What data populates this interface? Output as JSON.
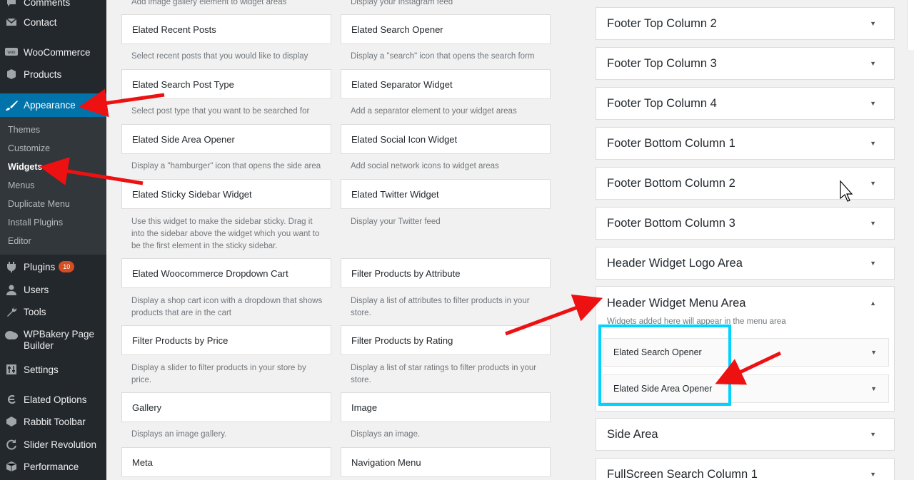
{
  "sidebar": {
    "top_cut": "Comments",
    "items": [
      {
        "label": "Contact",
        "icon": "mail-icon"
      },
      {
        "label": "WooCommerce",
        "icon": "woocommerce-icon"
      },
      {
        "label": "Products",
        "icon": "box-icon"
      },
      {
        "label": "Appearance",
        "icon": "paintbrush-icon"
      },
      {
        "label": "Plugins",
        "icon": "plug-icon",
        "badge": "10"
      },
      {
        "label": "Users",
        "icon": "user-icon"
      },
      {
        "label": "Tools",
        "icon": "wrench-icon"
      },
      {
        "label": "WPBakery Page Builder",
        "icon": "wpbakery-icon"
      },
      {
        "label": "Settings",
        "icon": "sliders-icon"
      },
      {
        "label": "Elated Options",
        "icon": "elated-icon"
      },
      {
        "label": "Rabbit Toolbar",
        "icon": "rabbit-icon"
      },
      {
        "label": "Slider Revolution",
        "icon": "refresh-icon"
      },
      {
        "label": "Performance",
        "icon": "cube-icon"
      }
    ],
    "submenu": [
      "Themes",
      "Customize",
      "Widgets",
      "Menus",
      "Duplicate Menu",
      "Install Plugins",
      "Editor"
    ]
  },
  "widgets": {
    "top_desc_left": "Add image gallery element to widget areas",
    "top_desc_right": "Display your Instagram feed",
    "rows": [
      [
        {
          "title": "Elated Recent Posts",
          "desc": "Select recent posts that you would like to display"
        },
        {
          "title": "Elated Search Opener",
          "desc": "Display a \"search\" icon that opens the search form"
        }
      ],
      [
        {
          "title": "Elated Search Post Type",
          "desc": "Select post type that you want to be searched for"
        },
        {
          "title": "Elated Separator Widget",
          "desc": "Add a separator element to your widget areas"
        }
      ],
      [
        {
          "title": "Elated Side Area Opener",
          "desc": "Display a \"hamburger\" icon that opens the side area"
        },
        {
          "title": "Elated Social Icon Widget",
          "desc": "Add social network icons to widget areas"
        }
      ],
      [
        {
          "title": "Elated Sticky Sidebar Widget",
          "desc": "Use this widget to make the sidebar sticky. Drag it into the sidebar above the widget which you want to be the first element in the sticky sidebar."
        },
        {
          "title": "Elated Twitter Widget",
          "desc": "Display your Twitter feed"
        }
      ],
      [
        {
          "title": "Elated Woocommerce Dropdown Cart",
          "desc": "Display a shop cart icon with a dropdown that shows products that are in the cart"
        },
        {
          "title": "Filter Products by Attribute",
          "desc": "Display a list of attributes to filter products in your store."
        }
      ],
      [
        {
          "title": "Filter Products by Price",
          "desc": "Display a slider to filter products in your store by price."
        },
        {
          "title": "Filter Products by Rating",
          "desc": "Display a list of star ratings to filter products in your store."
        }
      ],
      [
        {
          "title": "Gallery",
          "desc": "Displays an image gallery."
        },
        {
          "title": "Image",
          "desc": "Displays an image."
        }
      ],
      [
        {
          "title": "Meta",
          "desc": ""
        },
        {
          "title": "Navigation Menu",
          "desc": ""
        }
      ]
    ]
  },
  "areas": {
    "list_top": [
      "Footer Top Column 2",
      "Footer Top Column 3",
      "Footer Top Column 4",
      "Footer Bottom Column 1",
      "Footer Bottom Column 2",
      "Footer Bottom Column 3",
      "Header Widget Logo Area"
    ],
    "open": {
      "title": "Header Widget Menu Area",
      "desc": "Widgets added here will appear in the menu area",
      "widgets": [
        "Elated Search Opener",
        "Elated Side Area Opener"
      ]
    },
    "list_bottom": [
      "Side Area",
      "FullScreen Search Column 1"
    ]
  },
  "colors": {
    "admin_bar": "#23282d",
    "active": "#0073aa",
    "arrow": "#ee1111",
    "highlight": "#00d3ff"
  }
}
